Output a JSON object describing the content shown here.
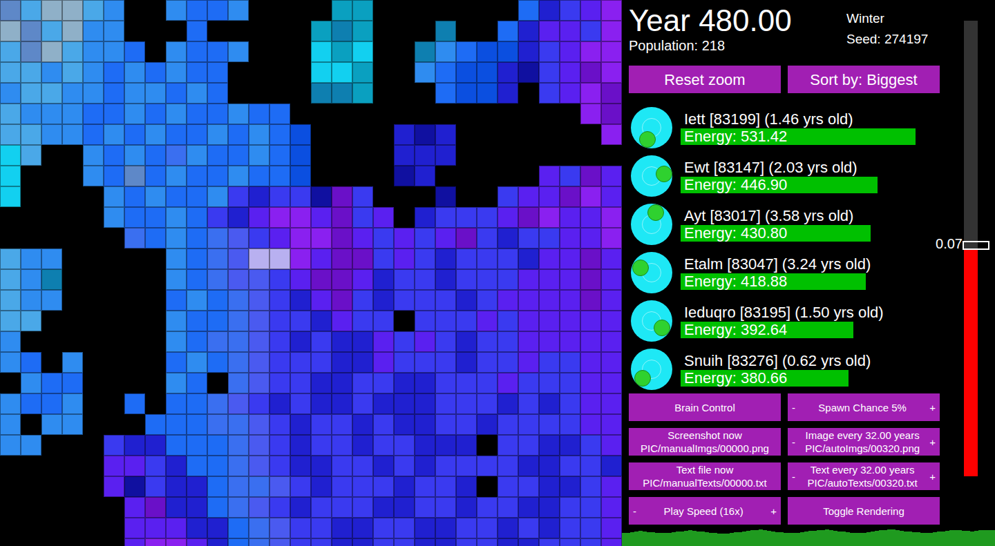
{
  "header": {
    "year": "Year 480.00",
    "population": "Population: 218",
    "season": "Winter",
    "seed": "Seed: 274197"
  },
  "top_buttons": [
    "Reset zoom",
    "Sort by: Biggest"
  ],
  "creatures": [
    {
      "name": "Iett [83199] (1.46 yrs old)",
      "energy": "Energy: 531.42",
      "level": 0.907,
      "facing": 108
    },
    {
      "name": "Ewt [83147] (2.03 yrs old)",
      "energy": "Energy: 446.90",
      "level": 0.76,
      "facing": -10
    },
    {
      "name": "Ayt [83017] (3.58 yrs old)",
      "energy": "Energy: 430.80",
      "level": 0.733,
      "facing": -72
    },
    {
      "name": "Etalm [83047] (3.24 yrs old)",
      "energy": "Energy: 418.88",
      "level": 0.715,
      "facing": 204
    },
    {
      "name": "Ieduqro [83195] (1.50 yrs old)",
      "energy": "Energy: 392.64",
      "level": 0.667,
      "facing": 34
    },
    {
      "name": "Snuih [83276] (0.62 yrs old)",
      "energy": "Energy: 380.66",
      "level": 0.648,
      "facing": 135
    }
  ],
  "controls": [
    {
      "kind": "button",
      "label": "Brain Control"
    },
    {
      "kind": "stepper",
      "minus": "-",
      "label": "Spawn Chance 5%",
      "plus": "+"
    },
    {
      "kind": "button",
      "label": "Screenshot now",
      "path": "PIC/manualImgs/00000.png"
    },
    {
      "kind": "stepper",
      "minus": "-",
      "label": "Image every 32.00 years",
      "plus": "+",
      "path": "PIC/autoImgs/00320.png"
    },
    {
      "kind": "button",
      "label": "Text file now",
      "path": "PIC/manualTexts/00000.txt"
    },
    {
      "kind": "stepper",
      "minus": "-",
      "label": "Text every 32.00 years",
      "plus": "+",
      "path": "PIC/autoTexts/00320.txt"
    },
    {
      "kind": "stepper",
      "minus": "-",
      "label": "Play Speed (16x)",
      "plus": "+"
    },
    {
      "kind": "button",
      "label": "Toggle Rendering"
    }
  ],
  "slider": {
    "reading": "0.07",
    "level": 0.5
  },
  "map": {
    "palette": {
      ".": "#000000",
      "a": "#8fb0c8",
      "b": "#4aa8e8",
      "c": "#2f8cf0",
      "d": "#1e6cf5",
      "e": "#0b4fe0",
      "f": "#12d0f0",
      "g": "#0aa0c0",
      "h": "#3a6ff0",
      "i": "#3a3af0",
      "j": "#2020d0",
      "k": "#5a20f0",
      "l": "#8a20f0",
      "m": "#6a10c8",
      "n": "#1010a0",
      "o": "#b8b0f0",
      "p": "#4a5af0",
      "q": "#0e7fb0",
      "r": "#5e88c8"
    },
    "rows": [
      "rbaabc..cddc....gg.......djikl",
      "arbacc...d.....gqg...q..djkkil",
      "brabccd.cddc...fgf..qcdeejikll",
      "bbcbcdcdcdd....ffg..cdeejnikml",
      "cbbccdccdcd....qqg...deej.iklm",
      "bcccddcdcddcdd..............lm",
      "bbccdcdcddcdcde....jnj.......l",
      "fb..cdcdhcddcde....jjj........",
      "f...cdrdcddcdde....nj.....kimk",
      "f....cdcddcijiinmi...n..ikkmlk",
      ".....cddcdijkllkmik.jiiikmlkkl",
      "......hdcdhpikllmkikikmijiikkl",
      "bcc.....cdhpoolkmmikijiiijkkmk",
      "bcq.....cdhppikmmkjiijiiikkkmk",
      "bcc.....dcdhpijkmijiiijikkkkmk",
      "bb......cddhpiijkii.iiikikkkkk",
      "c.......cdhhpijijjkikijiikkkkk",
      "cd.c....dcdhpiiijjkiiijiikiikk",
      ".cdd....cd.hpiijjiijjiiikiiikk",
      "cddc..d.ddhpijijjijjjiiijijikk",
      "c.cc...dddhhpijiijijjiijiiiikk",
      "cc...ijjdddhpijiijiijjj.iijjik",
      ".....kkijddhpijjiijijiiiijjiij",
      ".....knijjdhhpijiiijiij.iijjik",
      "......kmjjdhpijiiijjiijiijjiik",
      "......kkkjjdhpiijjiijjiijijiik",
      "......kllkjdhpiijjiijjiijjiiik"
    ]
  },
  "population_history": [
    180,
    185,
    190,
    200,
    210,
    205,
    195,
    190,
    185,
    180,
    178,
    182,
    190,
    198,
    206,
    212,
    220,
    215,
    205,
    198,
    192,
    186,
    180,
    176,
    172,
    175,
    182,
    190,
    196,
    204,
    210,
    216,
    222,
    226,
    218,
    210,
    200,
    194,
    188,
    184,
    180,
    178,
    184,
    192,
    200,
    208,
    214,
    220,
    224,
    228,
    222,
    214,
    206,
    198,
    190,
    186,
    182,
    180,
    186,
    194,
    202,
    210,
    218,
    224,
    230,
    226,
    218,
    210,
    204,
    198,
    192,
    188,
    184,
    182,
    186,
    192,
    200,
    206,
    212,
    216,
    220,
    218,
    214,
    210,
    206,
    212,
    216,
    220,
    218,
    218
  ]
}
